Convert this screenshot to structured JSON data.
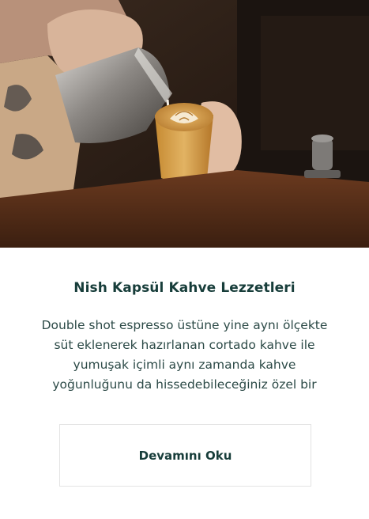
{
  "card": {
    "title": "Nish Kapsül Kahve Lezzetleri",
    "description_lines": [
      "Double shot espresso üstüne yine aynı ölçekte",
      "süt eklenerek hazırlanan cortado kahve ile",
      "yumuşak içimli aynı zamanda kahve",
      "yoğunluğunu da hissedebileceğiniz özel bir"
    ],
    "button_label": "Devamını Oku"
  },
  "colors": {
    "title": "#173d3a",
    "text": "#2c4a47",
    "button_border": "#e3e3e3"
  }
}
